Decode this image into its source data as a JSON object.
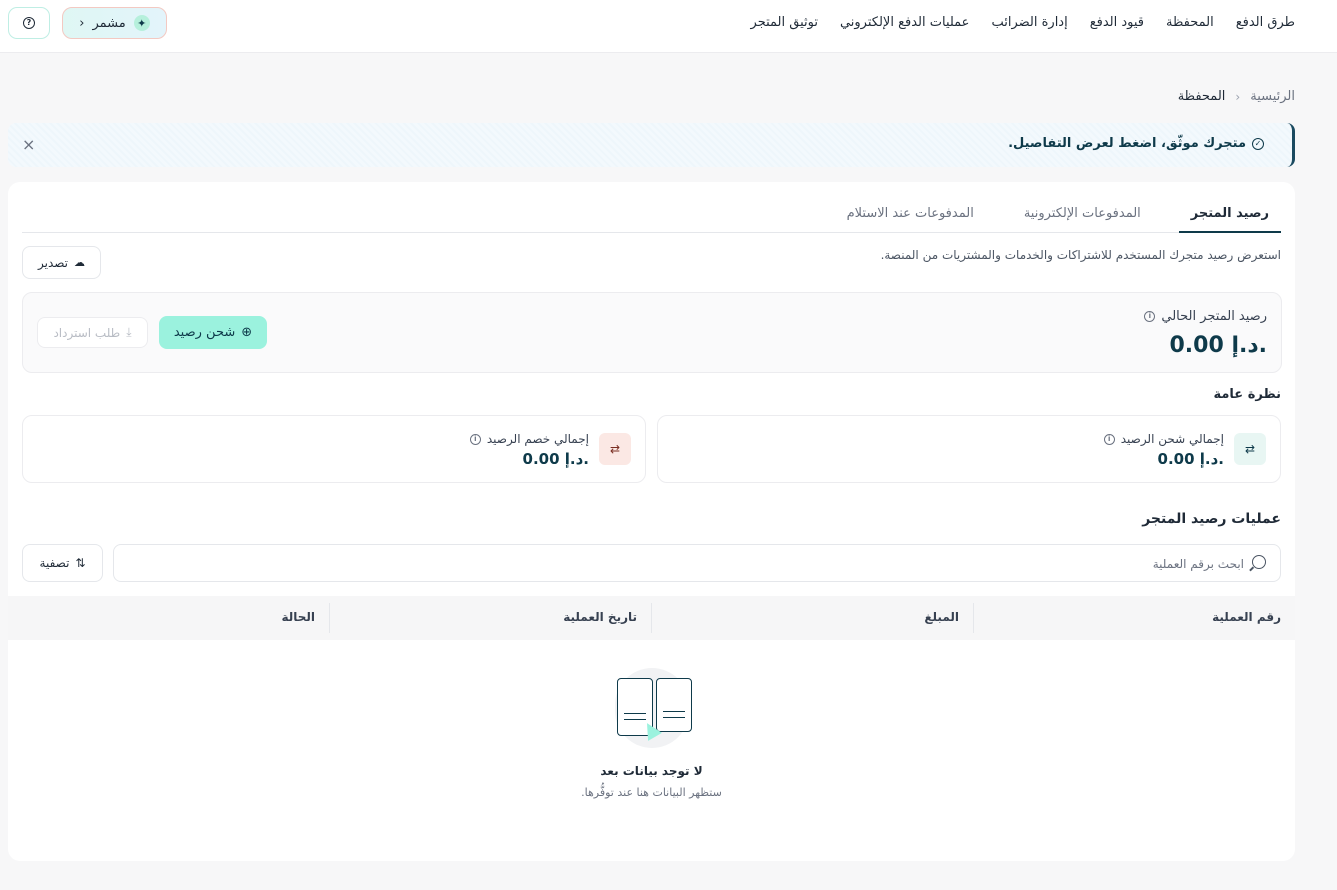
{
  "topnav": {
    "items": [
      "طرق الدفع",
      "المحفظة",
      "قيود الدفع",
      "إدارة الضرائب",
      "عمليات الدفع الإلكتروني",
      "توثيق المتجر"
    ]
  },
  "plan": {
    "label": "مشمر"
  },
  "breadcrumb": {
    "home": "الرئيسية",
    "current": "المحفظة"
  },
  "alert": {
    "text": "متجرك موثّق، اضغط لعرض التفاصيل."
  },
  "tabs": [
    {
      "label": "رصيد المتجر",
      "active": true
    },
    {
      "label": "المدفوعات الإلكترونية",
      "active": false
    },
    {
      "label": "المدفوعات عند الاستلام",
      "active": false
    }
  ],
  "description": "استعرض رصيد متجرك المستخدم للاشتراكات والخدمات والمشتريات من المنصة.",
  "export_label": "تصدير",
  "balance": {
    "label": "رصيد المتجر الحالي",
    "value": "0.00 د.إ.",
    "charge_label": "شحن رصيد",
    "refund_label": "طلب استرداد"
  },
  "overview": {
    "title": "نظرة عامة",
    "charge_total": {
      "label": "إجمالي شحن الرصيد",
      "value": "0.00 د.إ."
    },
    "deduct_total": {
      "label": "إجمالي خصم الرصيد",
      "value": "0.00 د.إ."
    }
  },
  "operations": {
    "title": "عمليات رصيد المتجر",
    "search_placeholder": "ابحث برقم العملية",
    "filter_label": "تصفية",
    "columns": [
      "رقم العملية",
      "المبلغ",
      "تاريخ العملية",
      "الحالة"
    ]
  },
  "empty_state": {
    "title": "لا توجد بيانات بعد",
    "subtitle": "ستظهر البيانات هنا عند توفُّرها."
  },
  "colors": {
    "brand": "#0e3a4a",
    "accent": "#9bf2de",
    "background": "#f7f7f8"
  }
}
